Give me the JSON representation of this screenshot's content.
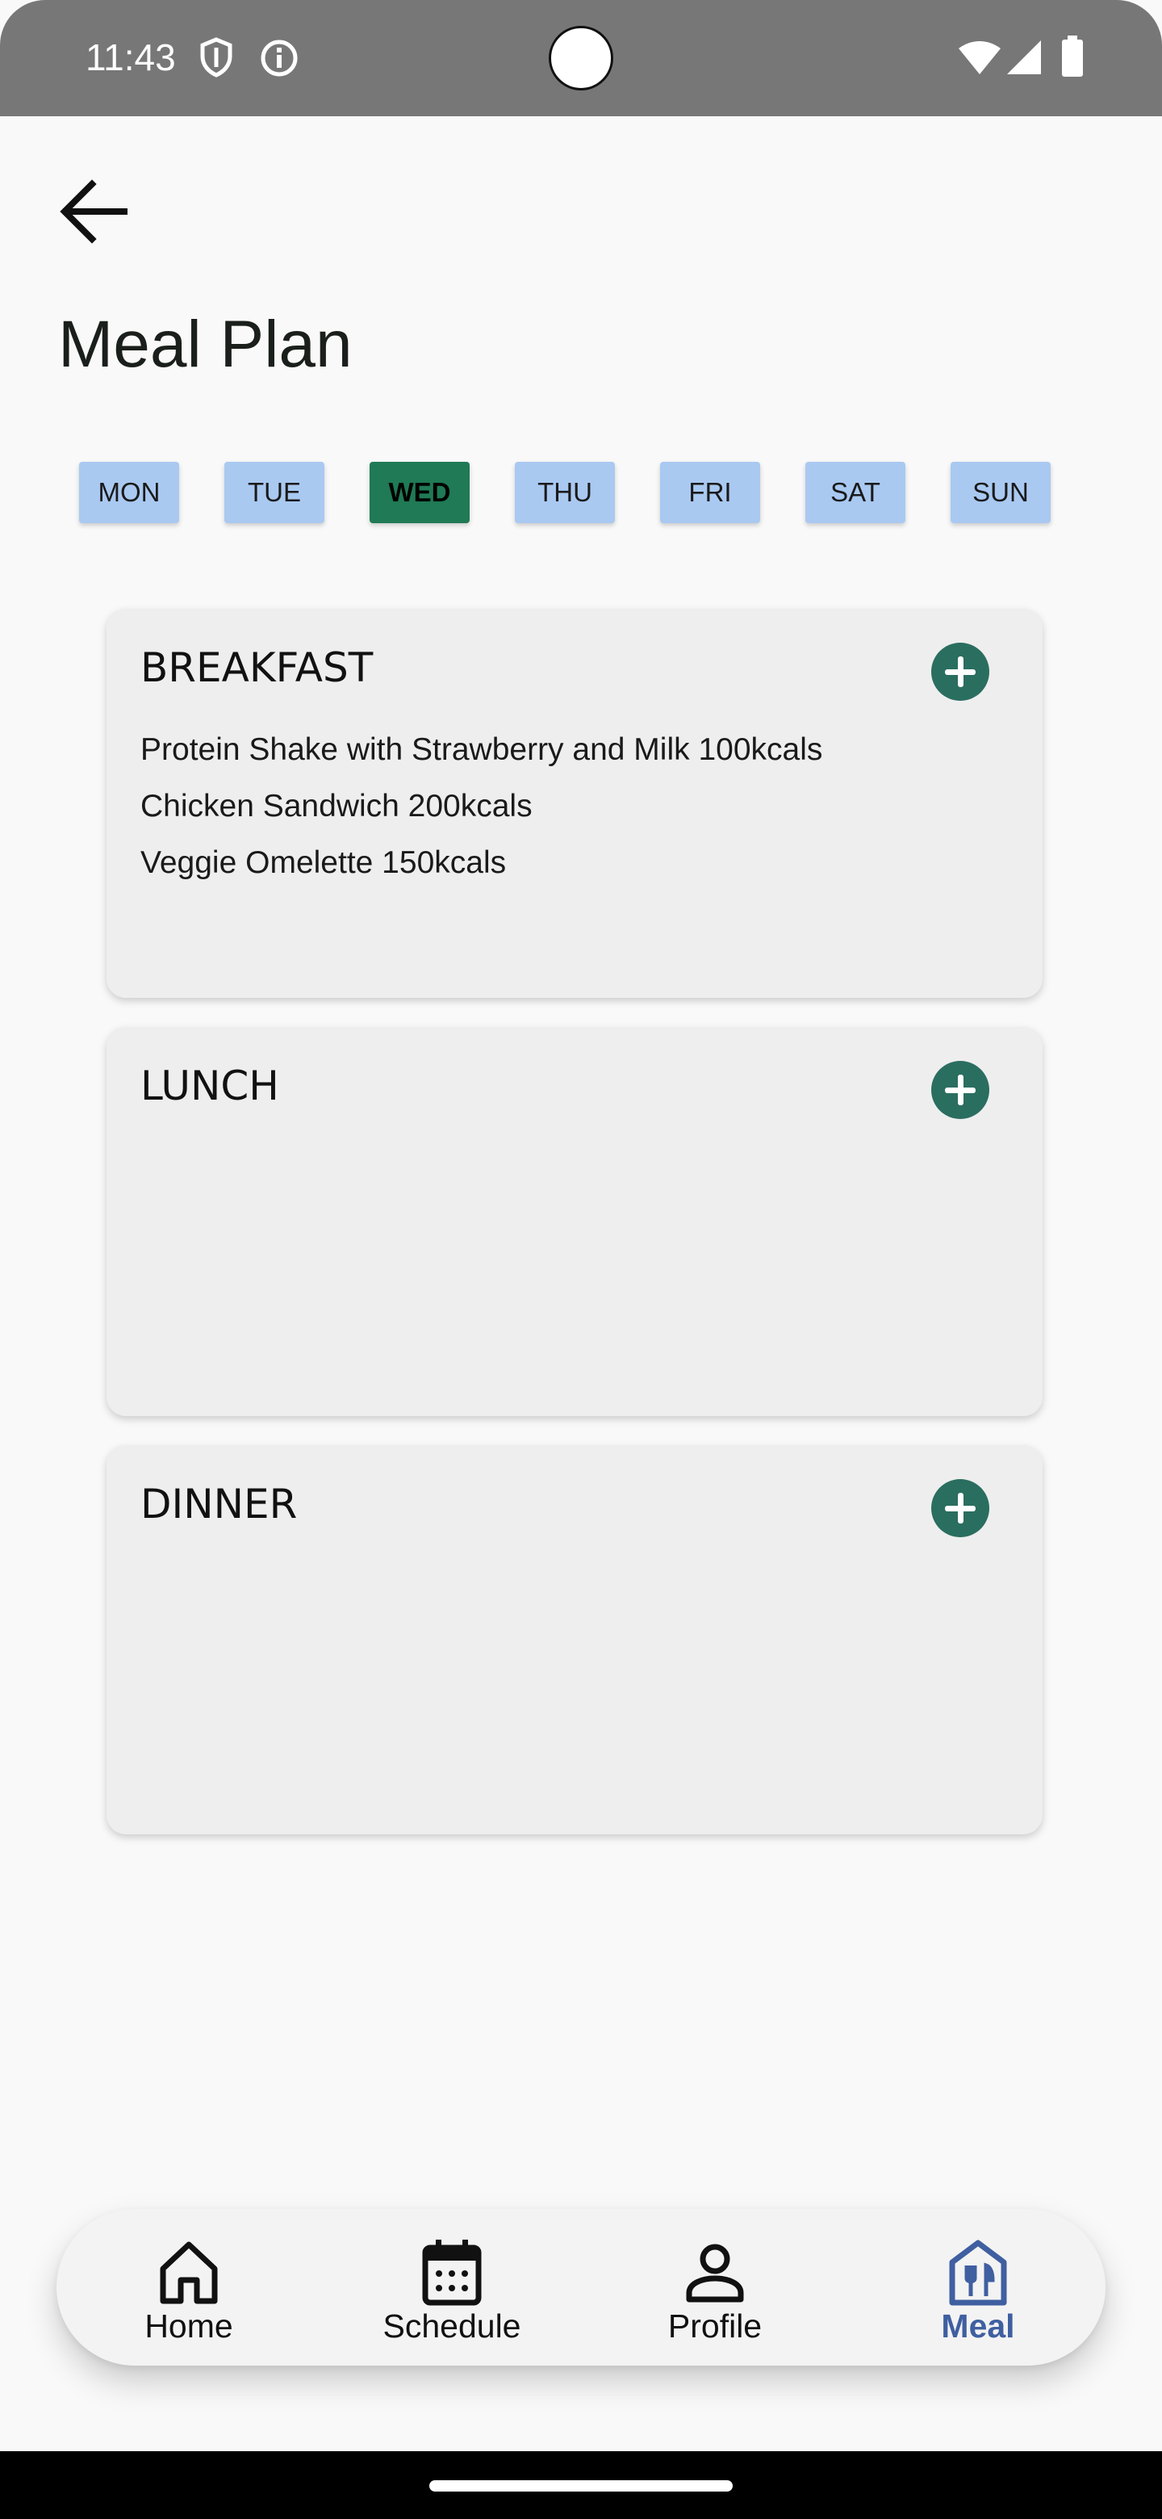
{
  "status_bar": {
    "time": "11:43",
    "icons": [
      "shield-icon",
      "info-icon",
      "wifi-icon",
      "signal-icon",
      "battery-icon"
    ]
  },
  "header": {
    "back_icon": "arrow-back-icon",
    "title": "Meal Plan"
  },
  "days": [
    {
      "label": "MON",
      "selected": false
    },
    {
      "label": "TUE",
      "selected": false
    },
    {
      "label": "WED",
      "selected": true
    },
    {
      "label": "THU",
      "selected": false
    },
    {
      "label": "FRI",
      "selected": false
    },
    {
      "label": "SAT",
      "selected": false
    },
    {
      "label": "SUN",
      "selected": false
    }
  ],
  "meals": [
    {
      "title": "BREAKFAST",
      "items": [
        "Protein Shake with Strawberry and Milk 100kcals",
        "Chicken Sandwich 200kcals",
        "Veggie Omelette 150kcals"
      ]
    },
    {
      "title": "LUNCH",
      "items": []
    },
    {
      "title": "DINNER",
      "items": []
    }
  ],
  "bottom_nav": [
    {
      "label": "Home",
      "icon": "home-icon",
      "active": false
    },
    {
      "label": "Schedule",
      "icon": "calendar-icon",
      "active": false
    },
    {
      "label": "Profile",
      "icon": "person-icon",
      "active": false
    },
    {
      "label": "Meal",
      "icon": "restaurant-icon",
      "active": true
    }
  ],
  "colors": {
    "accent": "#2a6e60",
    "selected_day": "#1f7a55",
    "day_chip": "#a9c9f1",
    "nav_active": "#3f5fa1"
  }
}
